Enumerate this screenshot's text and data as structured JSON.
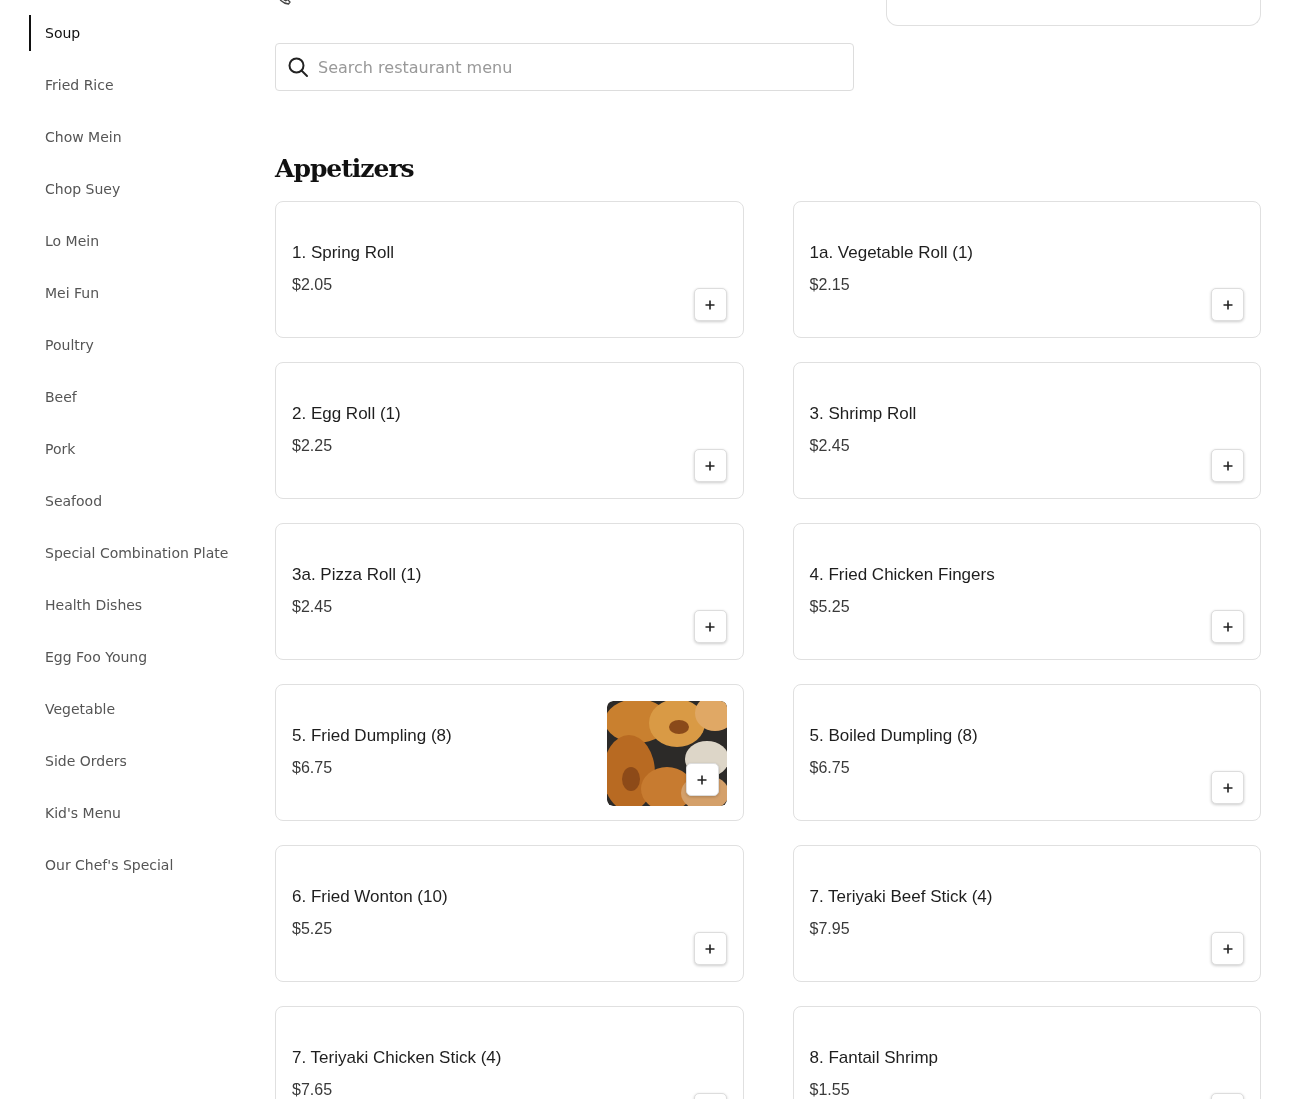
{
  "sidebar": {
    "items": [
      {
        "label": "Soup",
        "selected": true
      },
      {
        "label": "Fried Rice",
        "selected": false
      },
      {
        "label": "Chow Mein",
        "selected": false
      },
      {
        "label": "Chop Suey",
        "selected": false
      },
      {
        "label": "Lo Mein",
        "selected": false
      },
      {
        "label": "Mei Fun",
        "selected": false
      },
      {
        "label": "Poultry",
        "selected": false
      },
      {
        "label": "Beef",
        "selected": false
      },
      {
        "label": "Pork",
        "selected": false
      },
      {
        "label": "Seafood",
        "selected": false
      },
      {
        "label": "Special Combination Plate",
        "selected": false
      },
      {
        "label": "Health Dishes",
        "selected": false
      },
      {
        "label": "Egg Foo Young",
        "selected": false
      },
      {
        "label": "Vegetable",
        "selected": false
      },
      {
        "label": "Side Orders",
        "selected": false
      },
      {
        "label": "Kid's Menu",
        "selected": false
      },
      {
        "label": "Our Chef's Special",
        "selected": false
      }
    ]
  },
  "search": {
    "placeholder": "Search restaurant menu"
  },
  "section": {
    "title": "Appetizers",
    "items": [
      {
        "name": "1. Spring Roll",
        "price": "$2.05"
      },
      {
        "name": "1a. Vegetable Roll (1)",
        "price": "$2.15"
      },
      {
        "name": "2. Egg Roll (1)",
        "price": "$2.25"
      },
      {
        "name": "3. Shrimp Roll",
        "price": "$2.45"
      },
      {
        "name": "3a. Pizza Roll (1)",
        "price": "$2.45"
      },
      {
        "name": "4. Fried Chicken Fingers",
        "price": "$5.25"
      },
      {
        "name": "5. Fried Dumpling (8)",
        "price": "$6.75"
      },
      {
        "name": "5. Boiled Dumpling (8)",
        "price": "$6.75"
      },
      {
        "name": "6. Fried Wonton (10)",
        "price": "$5.25"
      },
      {
        "name": "7. Teriyaki Beef Stick (4)",
        "price": "$7.95"
      },
      {
        "name": "7. Teriyaki Chicken Stick (4)",
        "price": "$7.65"
      },
      {
        "name": "8. Fantail Shrimp",
        "price": "$1.55"
      }
    ]
  }
}
